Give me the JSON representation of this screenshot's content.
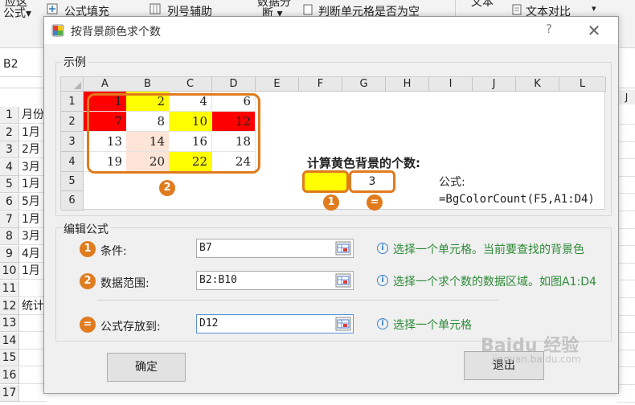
{
  "ribbon": {
    "top_fragment_1": "应这",
    "formula_label": "公式▾",
    "fill_formula": "公式填充",
    "col_helper": "列号辅助",
    "top_fragment_2": "数据分",
    "split_label": "断 ▾",
    "check_empty": "判断单元格是否为空",
    "top_fragment_3": "文本",
    "text_compare": "文本对比",
    "dropdown": "▾"
  },
  "sheet": {
    "name_box": "B2",
    "col_J": "J",
    "rows": [
      {
        "num": "1",
        "text": "月份"
      },
      {
        "num": "2",
        "text": "1月"
      },
      {
        "num": "3",
        "text": "2月"
      },
      {
        "num": "4",
        "text": "3月"
      },
      {
        "num": "5",
        "text": "1月"
      },
      {
        "num": "6",
        "text": "5月"
      },
      {
        "num": "7",
        "text": "1月"
      },
      {
        "num": "8",
        "text": "3月"
      },
      {
        "num": "9",
        "text": "4月"
      },
      {
        "num": "10",
        "text": "1月"
      },
      {
        "num": "11",
        "text": ""
      },
      {
        "num": "12",
        "text": "统计"
      },
      {
        "num": "13",
        "text": ""
      },
      {
        "num": "14",
        "text": ""
      },
      {
        "num": "15",
        "text": ""
      },
      {
        "num": "16",
        "text": ""
      },
      {
        "num": "17",
        "text": ""
      }
    ]
  },
  "dialog": {
    "title": "按背景颜色求个数",
    "help": "?",
    "close": "✕",
    "example_label": "示例",
    "example": {
      "col_headers": [
        "A",
        "B",
        "C",
        "D",
        "E",
        "F",
        "G",
        "H",
        "I",
        "J",
        "K",
        "L"
      ],
      "row_headers": [
        "1",
        "2",
        "3",
        "4",
        "5",
        "6"
      ],
      "cells": [
        [
          {
            "v": "1",
            "bg": "#ff0000"
          },
          {
            "v": "2",
            "bg": "#ffff00"
          },
          {
            "v": "4",
            "bg": "#ffffff"
          },
          {
            "v": "6",
            "bg": "#ffffff"
          }
        ],
        [
          {
            "v": "7",
            "bg": "#ff0000"
          },
          {
            "v": "8",
            "bg": "#ffffff"
          },
          {
            "v": "10",
            "bg": "#ffff00"
          },
          {
            "v": "12",
            "bg": "#ff0000"
          }
        ],
        [
          {
            "v": "13",
            "bg": "#ffffff"
          },
          {
            "v": "14",
            "bg": "#fce4d6"
          },
          {
            "v": "16",
            "bg": "#ffffff"
          },
          {
            "v": "18",
            "bg": "#ffffff"
          }
        ],
        [
          {
            "v": "19",
            "bg": "#ffffff"
          },
          {
            "v": "20",
            "bg": "#fce4d6"
          },
          {
            "v": "22",
            "bg": "#ffff00"
          },
          {
            "v": "24",
            "bg": "#ffffff"
          }
        ]
      ],
      "caption": "计算黄色背景的个数:",
      "result_value": "3",
      "formula_label": "公式:",
      "formula": "=BgColorCount(F5,A1:D4)",
      "badge_1": "1",
      "badge_2": "2",
      "badge_eq": "="
    },
    "edit_label": "编辑公式",
    "fields": [
      {
        "badge": "1",
        "label": "条件:",
        "value": "B7",
        "hint": "选择一个单元格。当前要查找的背景色"
      },
      {
        "badge": "2",
        "label": "数据范围:",
        "value": "B2:B10",
        "hint": "选择一个求个数的数据区域。如图A1:D4"
      },
      {
        "badge": "=",
        "label": "公式存放到:",
        "value": "D12",
        "hint": "选择一个单元格"
      }
    ],
    "ok": "确定",
    "cancel": "退出"
  },
  "watermark": {
    "main": "Baidu 经验",
    "sub": "jingyan.baidu.com"
  },
  "colors": {
    "accent_orange": "#e07b1e",
    "hint_green": "#2d8a37",
    "red": "#ff0000",
    "yellow": "#ffff00"
  }
}
